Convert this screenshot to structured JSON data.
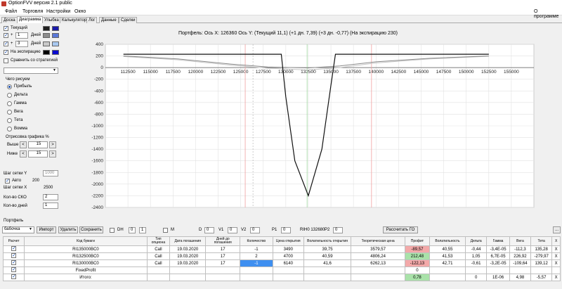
{
  "window": {
    "title": "OptionFVV версия 2.1 public"
  },
  "menu": {
    "items": [
      "Файл",
      "Торговля",
      "Настройки",
      "Окно"
    ],
    "about": "О программе"
  },
  "tabs": [
    "Доска",
    "Диаграмма",
    "Улыбка",
    "Калькулятор",
    "Лог",
    "Данные",
    "Сделки"
  ],
  "left": {
    "current_label": "Текущий",
    "plus1_sign": "+",
    "plus1_value": "1",
    "plus1_unit": "Дней",
    "plus3_sign": "+",
    "plus3_value": "3",
    "plus3_unit": "Дней",
    "expiry_label": "На экспирацию",
    "compare_label": "Сравнить со стратегией",
    "draw_label": "Чего рисуем",
    "radios": [
      "Прибыль",
      "Дельта",
      "Гамма",
      "Вега",
      "Тета",
      "Вомма"
    ],
    "drawing_label": "Отрисовка графика %",
    "above_label": "Выше",
    "above_value": "15",
    "below_label": "Ниже",
    "below_value": "15",
    "grid_y_label": "Шаг сетки Y",
    "grid_y_value": "1000",
    "auto_label": "Авто",
    "auto_value": "200",
    "grid_x_label": "Шаг сетки X",
    "grid_x_value": "2500",
    "sko_label": "Кол-во СКО",
    "sko_value": "2",
    "days_label": "Кол-во дней",
    "days_value": "1",
    "btn_left": "<",
    "btn_right": ">",
    "colors": {
      "current": "#1f1f1f",
      "current2": "#1a1aa8",
      "plus1": "#8c8c8c",
      "plus1b": "#5a78d8",
      "plus3": "#c9c9c9",
      "plus3b": "#a8c8f0",
      "expiry": "#000000",
      "expiry2": "#0a0ad0"
    }
  },
  "chart_data": {
    "type": "line",
    "title": "Портфель: Ось X: 126360 Ось Y:  (Текущий 11,1)  (+1 дн. 7,39)  (+3 дн. -0,77)  (На экспирацию 230)",
    "xlabel": "",
    "ylabel": "",
    "xlim": [
      110000,
      157500
    ],
    "ylim": [
      -2400,
      400
    ],
    "x_ticks": [
      "112500",
      "115000",
      "117500",
      "120000",
      "122500",
      "125000",
      "127500",
      "130000",
      "132500",
      "135000",
      "137500",
      "140000",
      "142500",
      "145000",
      "147500",
      "150000",
      "152500",
      "155000"
    ],
    "y_ticks": [
      "400",
      "200",
      "0",
      "-200",
      "-400",
      "-600",
      "-800",
      "-1000",
      "-1200",
      "-1400",
      "-1600",
      "-1800",
      "-2000",
      "-2200",
      "-2400"
    ],
    "x_tick_values": [
      112500,
      115000,
      117500,
      120000,
      122500,
      125000,
      127500,
      130000,
      132500,
      135000,
      137500,
      140000,
      142500,
      145000,
      147500,
      150000,
      152500,
      155000
    ],
    "y_tick_values": [
      400,
      200,
      0,
      -200,
      -400,
      -600,
      -800,
      -1000,
      -1200,
      -1400,
      -1600,
      -1800,
      -2000,
      -2200,
      -2400
    ],
    "vlines_red": [
      125500,
      139500
    ],
    "vline_green": 132360,
    "vline_black": 126360,
    "series": [
      {
        "color": "#111111",
        "x": [
          112000,
          129500,
          130000,
          131000,
          132500,
          134000,
          135000,
          135500,
          152500
        ],
        "y": [
          230,
          230,
          -500,
          -1600,
          -2200,
          -1400,
          -300,
          230,
          230
        ]
      },
      {
        "color": "#8a8a8a",
        "x": [
          112000,
          118000,
          124000,
          128000,
          132500,
          136000,
          140000,
          146000,
          152500
        ],
        "y": [
          200,
          150,
          60,
          10,
          -5,
          30,
          100,
          160,
          200
        ]
      },
      {
        "color": "#c4c4c4",
        "x": [
          112000,
          118000,
          124000,
          128000,
          132500,
          136000,
          140000,
          146000,
          152500
        ],
        "y": [
          190,
          135,
          40,
          -10,
          -40,
          0,
          80,
          150,
          195
        ]
      }
    ]
  },
  "portfolio": {
    "header": "Портфель",
    "strategy": "бабочка",
    "import_btn": "Импорт",
    "delete_btn": "Удалить",
    "save_btn": "Сохранить",
    "dh_label": "DH",
    "dh_value1": "0",
    "dh_value2": "1",
    "m_label": "M",
    "d_label": "D",
    "d_value": "0",
    "v1_label": "V1",
    "v1_value": "0",
    "v2_label": "V2",
    "v2_value": "0",
    "p1_label": "P1",
    "p1_value": "0",
    "ri_text": "RIH0 132680",
    "p2_label": "P2",
    "p2_value": "0",
    "calc_btn": "Рассчитать ГО",
    "menu_btn": "..."
  },
  "table": {
    "headers": [
      "Расчет",
      "Код бумаги",
      "Тип опциона",
      "Дата погашения",
      "Дней до погашения",
      "Количество",
      "Цена открытия",
      "Волатильность открытия",
      "Теоретическая цена",
      "Профит",
      "Волатильность",
      "Дельта",
      "Гамма",
      "Вега",
      "Тета",
      "X"
    ],
    "rows": [
      [
        "RI135000BC0",
        "Call",
        "19.03.2020",
        "17",
        "-1",
        "3490",
        "39,75",
        "3579,57",
        "-89,57",
        "40,55",
        "-0,44",
        "-3,4E-05",
        "-112,3",
        "135,28",
        "X"
      ],
      [
        "RI132500BC0",
        "Call",
        "19.03.2020",
        "17",
        "2",
        "4700",
        "40,59",
        "4806,24",
        "212,48",
        "41,53",
        "1,05",
        "6,7E-05",
        "226,92",
        "-279,97",
        "X"
      ],
      [
        "RI130000BC0",
        "Call",
        "19.03.2020",
        "17",
        "-1",
        "6140",
        "41,6",
        "6262,13",
        "-122,13",
        "42,71",
        "-0,61",
        "-3,2E-05",
        "-109,64",
        "139,12",
        "X"
      ]
    ],
    "fixed_label": "FixedProfit",
    "fixed_value": "0",
    "total_label": "Итого:",
    "total_profit": "0,78",
    "total_delta": "0",
    "total_gamma": "1E-06",
    "total_vega": "4,98",
    "total_theta": "-5,57",
    "total_x": "X"
  }
}
